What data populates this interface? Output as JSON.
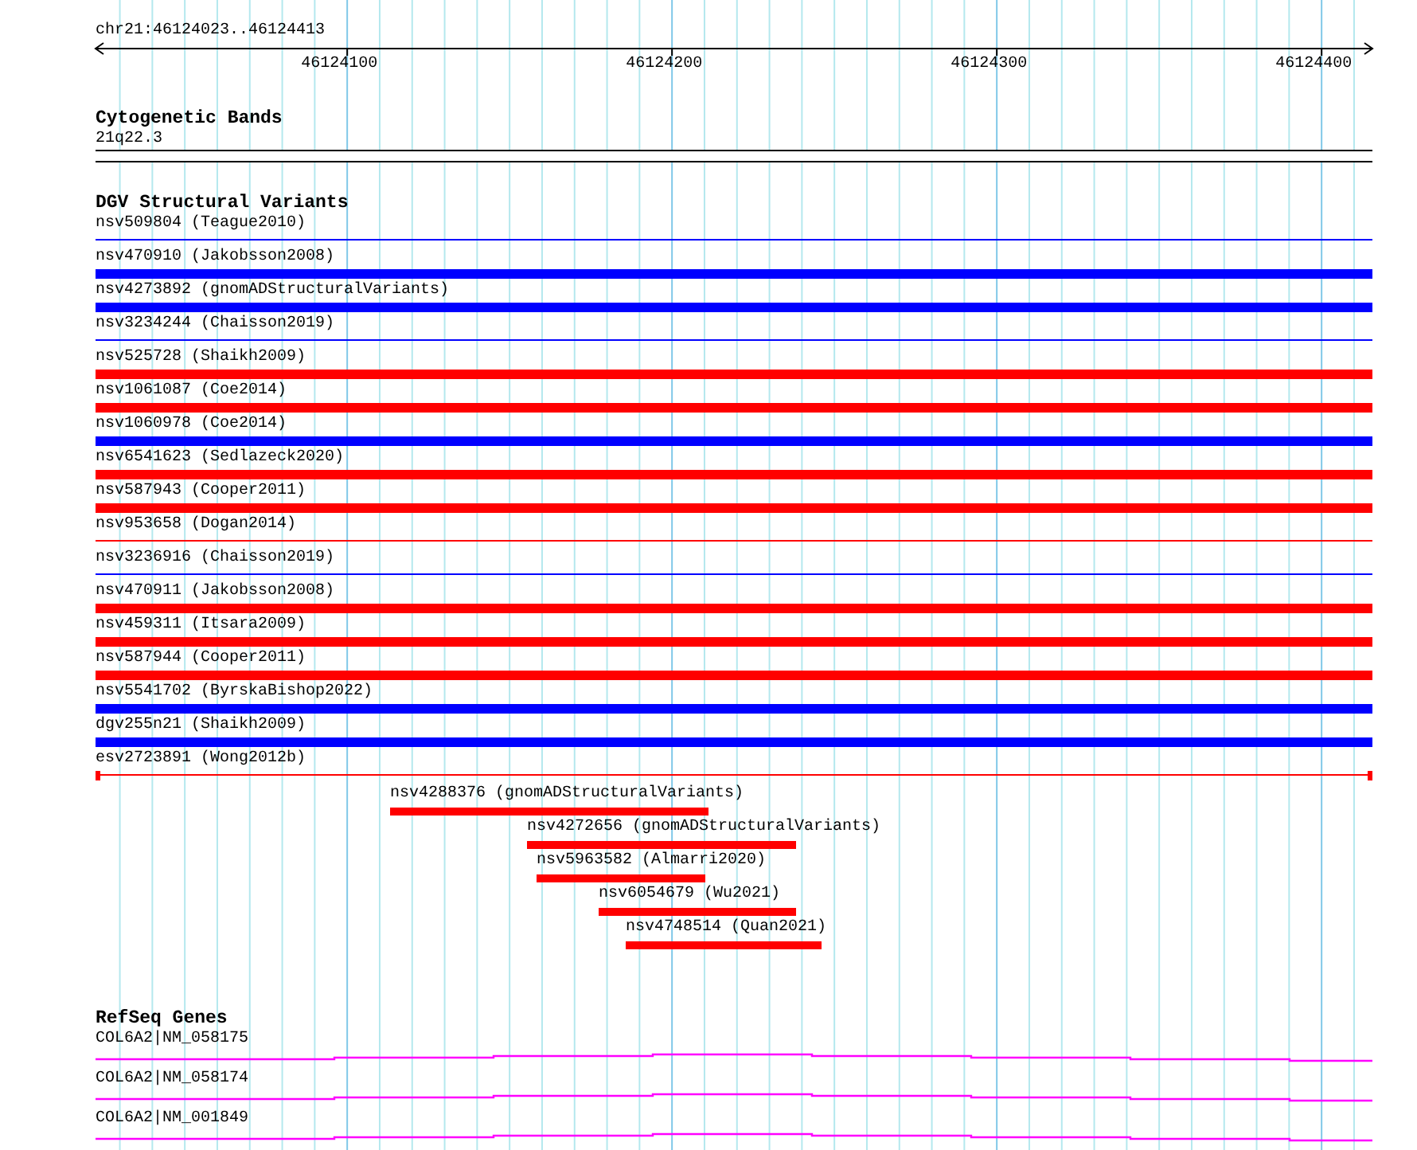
{
  "ruler": {
    "location": "chr21:46124023..46124413",
    "ticks": [
      "46124100",
      "46124200",
      "46124300",
      "46124400"
    ]
  },
  "cytogenetic_bands": {
    "title": "Cytogenetic Bands",
    "band": "21q22.3"
  },
  "dgv_structural_variants": {
    "title": "DGV Structural Variants",
    "features": [
      {
        "label": "nsv509804 (Teague2010)",
        "color": "#0000ff",
        "kind": "thin"
      },
      {
        "label": "nsv470910 (Jakobsson2008)",
        "color": "#0000ff",
        "kind": "thick"
      },
      {
        "label": "nsv4273892 (gnomADStructuralVariants)",
        "color": "#0000ff",
        "kind": "thick"
      },
      {
        "label": "nsv3234244 (Chaisson2019)",
        "color": "#0000ff",
        "kind": "thin"
      },
      {
        "label": "nsv525728 (Shaikh2009)",
        "color": "#ff0000",
        "kind": "thick"
      },
      {
        "label": "nsv1061087 (Coe2014)",
        "color": "#ff0000",
        "kind": "thick"
      },
      {
        "label": "nsv1060978 (Coe2014)",
        "color": "#0000ff",
        "kind": "thick"
      },
      {
        "label": "nsv6541623 (Sedlazeck2020)",
        "color": "#ff0000",
        "kind": "thick"
      },
      {
        "label": "nsv587943 (Cooper2011)",
        "color": "#ff0000",
        "kind": "thick"
      },
      {
        "label": "nsv953658 (Dogan2014)",
        "color": "#ff0000",
        "kind": "thin"
      },
      {
        "label": "nsv3236916 (Chaisson2019)",
        "color": "#0000ff",
        "kind": "thin"
      },
      {
        "label": "nsv470911 (Jakobsson2008)",
        "color": "#ff0000",
        "kind": "thick"
      },
      {
        "label": "nsv459311 (Itsara2009)",
        "color": "#ff0000",
        "kind": "thick"
      },
      {
        "label": "nsv587944 (Cooper2011)",
        "color": "#ff0000",
        "kind": "thick"
      },
      {
        "label": "nsv5541702 (ByrskaBishop2022)",
        "color": "#0000ff",
        "kind": "thick"
      },
      {
        "label": "dgv255n21 (Shaikh2009)",
        "color": "#0000ff",
        "kind": "thick"
      },
      {
        "label": "esv2723891 (Wong2012b)",
        "color": "#ff0000",
        "kind": "capped"
      }
    ],
    "stacked": [
      {
        "label": "nsv4288376 (gnomADStructuralVariants)",
        "color": "#ff0000"
      },
      {
        "label": "nsv4272656 (gnomADStructuralVariants)",
        "color": "#ff0000"
      },
      {
        "label": "nsv5963582 (Almarri2020)",
        "color": "#ff0000"
      },
      {
        "label": "nsv6054679 (Wu2021)",
        "color": "#ff0000"
      },
      {
        "label": "nsv4748514 (Quan2021)",
        "color": "#ff0000"
      }
    ]
  },
  "refseq_genes": {
    "title": "RefSeq Genes",
    "genes": [
      {
        "label": "COL6A2|NM_058175"
      },
      {
        "label": "COL6A2|NM_058174"
      },
      {
        "label": "COL6A2|NM_001849"
      }
    ]
  }
}
